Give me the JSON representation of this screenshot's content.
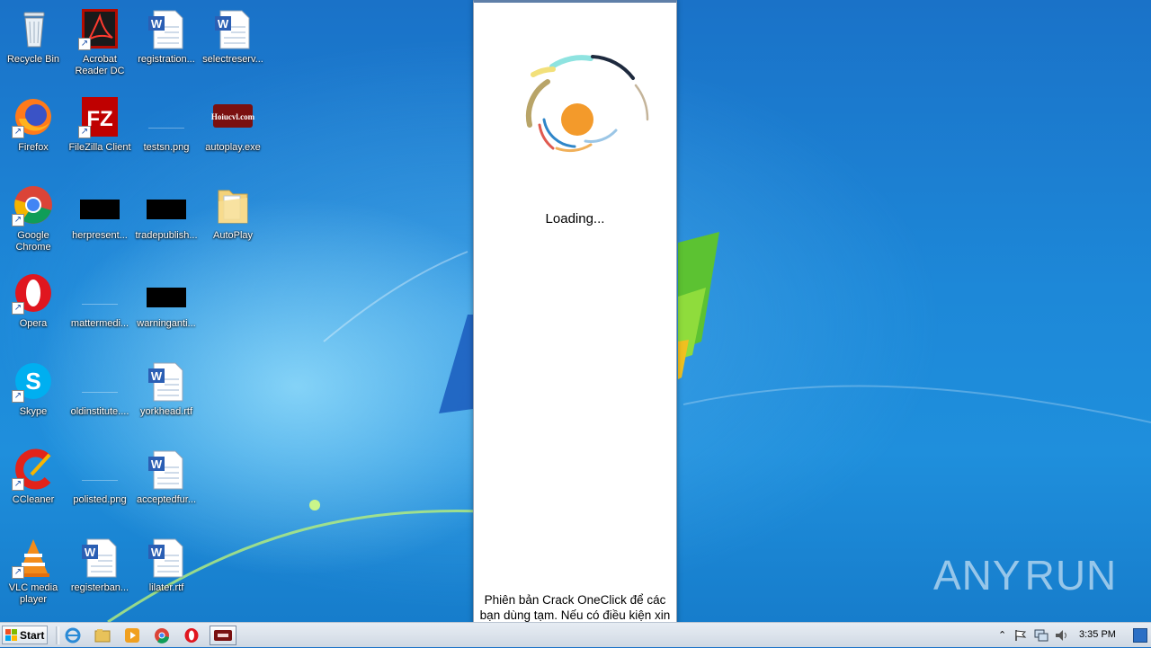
{
  "desktop": {
    "icons": [
      {
        "label": "Recycle Bin"
      },
      {
        "label": "Acrobat Reader DC"
      },
      {
        "label": "registration..."
      },
      {
        "label": "selectreserv..."
      },
      {
        "label": "Firefox"
      },
      {
        "label": "FileZilla Client"
      },
      {
        "label": "testsn.png"
      },
      {
        "label": "autoplay.exe"
      },
      {
        "label": "Google Chrome"
      },
      {
        "label": "herpresent..."
      },
      {
        "label": "tradepublish..."
      },
      {
        "label": "AutoPlay"
      },
      {
        "label": "Opera"
      },
      {
        "label": "mattermedi..."
      },
      {
        "label": "warninganti..."
      },
      {
        "label": "Skype"
      },
      {
        "label": "oldinstitute...."
      },
      {
        "label": "yorkhead.rtf"
      },
      {
        "label": "CCleaner"
      },
      {
        "label": "polisted.png"
      },
      {
        "label": "acceptedfur..."
      },
      {
        "label": "VLC media player"
      },
      {
        "label": "registerban..."
      },
      {
        "label": "lilater.rtf"
      }
    ],
    "autoplay_logo_text": "Hoiucvl.com"
  },
  "loader": {
    "loading_text": "Loading...",
    "notice": "Phiên bản Crack OneClick để các bạn dùng tạm. Nếu có điều kiện xin hãy mua LIC để ủng hộ tác giả."
  },
  "taskbar": {
    "start_label": "Start",
    "clock": "3:35 PM"
  },
  "watermark": {
    "text_left": "ANY",
    "text_right": "RUN"
  },
  "colors": {
    "spinner_center": "#f39a2b",
    "desktop_blue": "#1d88d8"
  }
}
